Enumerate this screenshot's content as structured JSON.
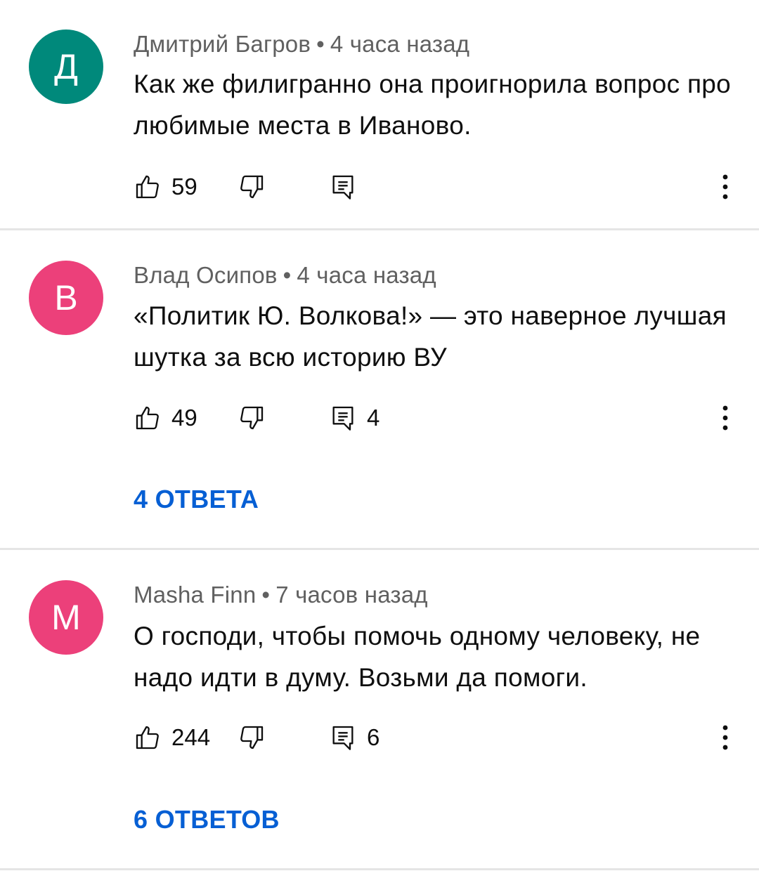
{
  "comments": [
    {
      "avatar_letter": "Д",
      "avatar_color": "#00897b",
      "author": "Дмитрий Багров",
      "separator": "•",
      "time": "4 часа назад",
      "text": "Как же филигранно она проигнорила вопрос про любимые места в Иваново.",
      "likes": "59",
      "reply_count": "",
      "replies_label": ""
    },
    {
      "avatar_letter": "В",
      "avatar_color": "#ec407a",
      "author": "Влад Осипов",
      "separator": "•",
      "time": "4 часа назад",
      "text": "«Политик Ю. Волкова!» — это наверное лучшая шутка за всю историю ВУ",
      "likes": "49",
      "reply_count": "4",
      "replies_label": "4 ОТВЕТА"
    },
    {
      "avatar_letter": "M",
      "avatar_color": "#ec407a",
      "author": "Masha Finn",
      "separator": "•",
      "time": "7 часов назад",
      "text": "О господи, чтобы помочь одному человеку, не надо идти в думу. Возьми да помоги.",
      "likes": "244",
      "reply_count": "6",
      "replies_label": "6 ОТВЕТОВ"
    }
  ],
  "icons": {
    "like": "thumb-up-icon",
    "dislike": "thumb-down-icon",
    "reply": "comment-icon",
    "more": "more-vert-icon"
  },
  "colors": {
    "link": "#065fd4",
    "meta": "#606060",
    "divider": "#e5e5e5"
  }
}
